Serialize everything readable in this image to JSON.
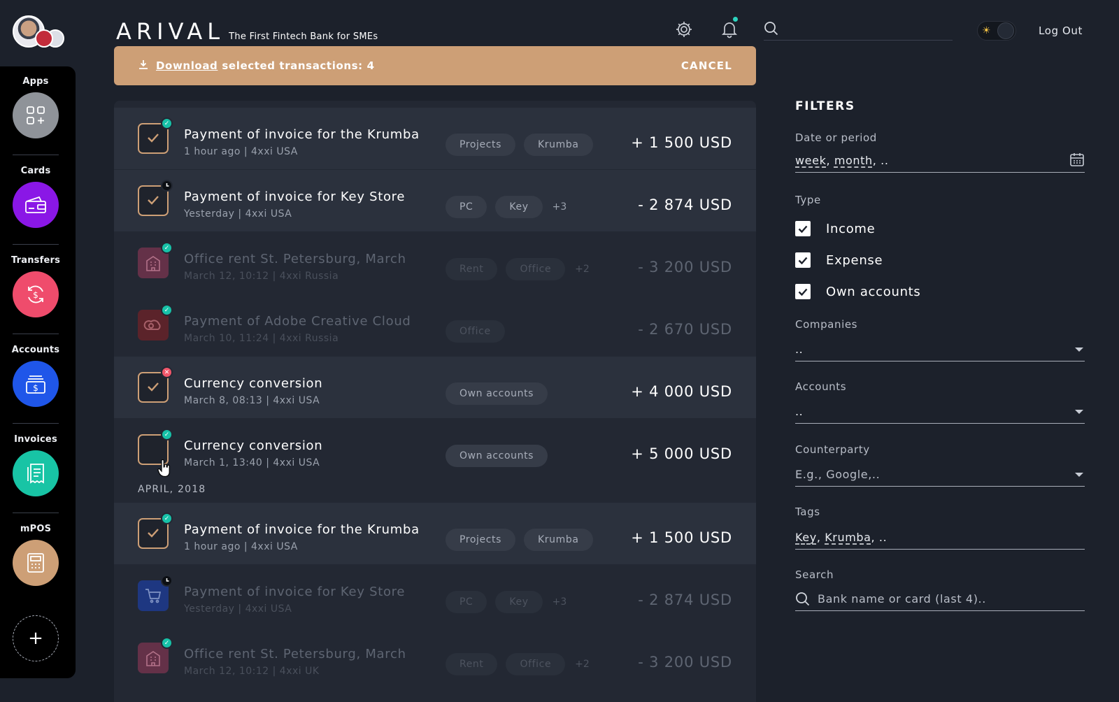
{
  "header": {
    "logo": "ARIVAL",
    "tagline": "The First Fintech Bank for SMEs",
    "logout": "Log Out"
  },
  "sidebar": {
    "items": [
      {
        "label": "Apps",
        "color": "#8f9399",
        "icon": "apps-grid-icon"
      },
      {
        "label": "Cards",
        "color": "#8a17e6",
        "icon": "wallet-card-icon"
      },
      {
        "label": "Transfers",
        "color": "#ef4c6c",
        "icon": "transfer-dollar-icon"
      },
      {
        "label": "Accounts",
        "color": "#1f56e9",
        "icon": "accounts-dollar-icon"
      },
      {
        "label": "Invoices",
        "color": "#18c4a5",
        "icon": "invoice-receipt-icon"
      },
      {
        "label": "mPOS",
        "color": "#cd9f76",
        "icon": "pos-terminal-icon"
      }
    ],
    "add": "+"
  },
  "banner": {
    "link": "Download",
    "text": "selected transactions: 4",
    "cancel": "CANCEL"
  },
  "transactions": [
    {
      "title": "Payment of invoice for the Krumba",
      "sub": "1 hour ago | 4xxi USA",
      "tags": [
        "Projects",
        "Krumba"
      ],
      "more": "",
      "amount": "+ 1 500 USD"
    },
    {
      "title": "Payment of invoice for Key Store",
      "sub": "Yesterday | 4xxi USA",
      "tags": [
        "PC",
        "Key"
      ],
      "more": "+3",
      "amount": "- 2 874 USD"
    },
    {
      "title": "Office rent St. Petersburg, March",
      "sub": "March 12, 10:12 | 4xxi Russia",
      "tags": [
        "Rent",
        "Office"
      ],
      "more": "+2",
      "amount": "- 3 200 USD"
    },
    {
      "title": "Payment of Adobe Creative Cloud",
      "sub": "March 10, 11:24 | 4xxi Russia",
      "tags": [
        "Office"
      ],
      "more": "",
      "amount": "- 2 670 USD"
    },
    {
      "title": "Currency conversion",
      "sub": "March 8, 08:13 | 4xxi USA",
      "tags": [
        "Own accounts"
      ],
      "more": "",
      "amount": "+ 4 000 USD"
    },
    {
      "title": "Currency conversion",
      "sub": "March 1, 13:40 | 4xxi USA",
      "tags": [
        "Own accounts"
      ],
      "more": "",
      "amount": "+ 5 000 USD"
    }
  ],
  "month_label": "APRIL, 2018",
  "transactions_april": [
    {
      "title": "Payment of invoice for the Krumba",
      "sub": "1 hour ago | 4xxi USA",
      "tags": [
        "Projects",
        "Krumba"
      ],
      "more": "",
      "amount": "+ 1 500 USD"
    },
    {
      "title": "Payment of invoice for Key Store",
      "sub": "Yesterday | 4xxi USA",
      "tags": [
        "PC",
        "Key"
      ],
      "more": "+3",
      "amount": "- 2 874 USD"
    },
    {
      "title": "Office rent St. Petersburg, March",
      "sub": "March 12, 10:12 | 4xxi UK",
      "tags": [
        "Rent",
        "Office"
      ],
      "more": "+2",
      "amount": "- 3 200 USD"
    }
  ],
  "filters": {
    "title": "FILTERS",
    "date_label": "Date or period",
    "date_value_parts": [
      "week",
      "month",
      ".."
    ],
    "type_label": "Type",
    "types": [
      "Income",
      "Expense",
      "Own accounts"
    ],
    "companies_label": "Companies",
    "companies_value": "..",
    "accounts_label": "Accounts",
    "accounts_value": "..",
    "counterparty_label": "Counterparty",
    "counterparty_placeholder": "E.g., Google,..",
    "tags_label": "Tags",
    "tags_value_parts": [
      "Key",
      "Krumba",
      ".."
    ],
    "search_label": "Search",
    "search_placeholder": "Bank name or card (last 4).."
  }
}
